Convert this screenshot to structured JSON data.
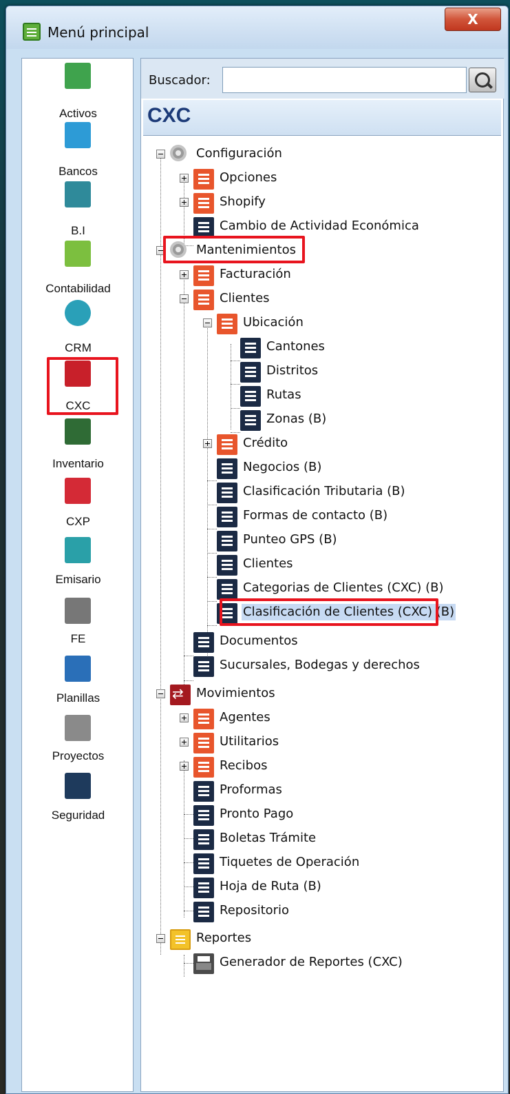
{
  "window": {
    "title": "Menú principal",
    "close_label": "X"
  },
  "sidebar": {
    "items": [
      {
        "label": "Activos",
        "icon": "cash-register-icon",
        "color": "#3fa34d"
      },
      {
        "label": "Bancos",
        "icon": "briefcase-icon",
        "color": "#2d9bd6"
      },
      {
        "label": "B.I",
        "icon": "lightbulb-icon",
        "color": "#2f8a9a"
      },
      {
        "label": "Contabilidad",
        "icon": "chart-icon",
        "color": "#7cbf3f"
      },
      {
        "label": "CRM",
        "icon": "globe-icon",
        "color": "#2aa0b8"
      },
      {
        "label": "CXC",
        "icon": "person-collect-icon",
        "color": "#c8202a"
      },
      {
        "label": "Inventario",
        "icon": "person-inventory-icon",
        "color": "#2f6b35"
      },
      {
        "label": "CXP",
        "icon": "person-pay-icon",
        "color": "#d42a36"
      },
      {
        "label": "Emisario",
        "icon": "envelope-icon",
        "color": "#2aa0a8"
      },
      {
        "label": "FE",
        "icon": "tools-icon",
        "color": "#777777"
      },
      {
        "label": "Planillas",
        "icon": "document-icon",
        "color": "#2a6fb8"
      },
      {
        "label": "Proyectos",
        "icon": "ruler-pencil-icon",
        "color": "#8a8a8a"
      },
      {
        "label": "Seguridad",
        "icon": "castle-icon",
        "color": "#1e3a5c"
      }
    ]
  },
  "search": {
    "label": "Buscador:",
    "value": ""
  },
  "section": {
    "title": "CXC"
  },
  "tree": [
    {
      "label": "Configuración"
    },
    {
      "label": "Opciones"
    },
    {
      "label": "Shopify"
    },
    {
      "label": "Cambio de Actividad Económica"
    },
    {
      "label": "Mantenimientos"
    },
    {
      "label": "Facturación"
    },
    {
      "label": "Clientes"
    },
    {
      "label": "Ubicación"
    },
    {
      "label": "Cantones"
    },
    {
      "label": "Distritos"
    },
    {
      "label": "Rutas"
    },
    {
      "label": "Zonas (B)"
    },
    {
      "label": "Crédito"
    },
    {
      "label": "Negocios (B)"
    },
    {
      "label": "Clasificación Tributaria (B)"
    },
    {
      "label": "Formas de contacto (B)"
    },
    {
      "label": "Punteo GPS (B)"
    },
    {
      "label": "Clientes"
    },
    {
      "label": "Categorias de Clientes (CXC) (B)"
    },
    {
      "label": "Clasificación de Clientes (CXC) (B)"
    },
    {
      "label": "Documentos"
    },
    {
      "label": "Sucursales, Bodegas y derechos"
    },
    {
      "label": "Movimientos"
    },
    {
      "label": "Agentes"
    },
    {
      "label": "Utilitarios"
    },
    {
      "label": "Recibos"
    },
    {
      "label": "Proformas"
    },
    {
      "label": "Pronto Pago"
    },
    {
      "label": "Boletas Trámite"
    },
    {
      "label": "Tiquetes de Operación"
    },
    {
      "label": "Hoja de Ruta (B)"
    },
    {
      "label": "Repositorio"
    },
    {
      "label": "Reportes"
    },
    {
      "label": "Generador de Reportes (CXC)"
    }
  ],
  "colors": {
    "highlight": "#e8141e",
    "selection": "#c7daf3",
    "section_title": "#1c3a78"
  }
}
